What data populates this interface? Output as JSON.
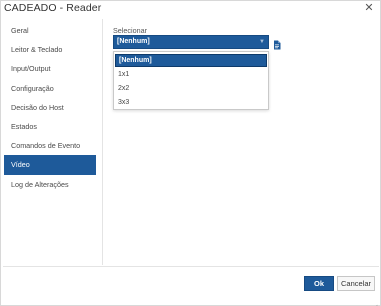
{
  "window": {
    "title": "CADEADO - Reader",
    "close_glyph": "✕"
  },
  "sidebar": {
    "items": [
      {
        "label": "Geral",
        "active": false
      },
      {
        "label": "Leitor & Teclado",
        "active": false
      },
      {
        "label": "Input/Output",
        "active": false
      },
      {
        "label": "Configuração",
        "active": false
      },
      {
        "label": "Decisão do Host",
        "active": false
      },
      {
        "label": "Estados",
        "active": false
      },
      {
        "label": "Comandos de Evento",
        "active": false
      },
      {
        "label": "Vídeo",
        "active": true
      },
      {
        "label": "Log de Alterações",
        "active": false
      }
    ]
  },
  "main": {
    "field_label": "Selecionar",
    "select": {
      "value": "[Nenhum]",
      "arrow_glyph": "▼",
      "icon": "document-icon"
    },
    "dropdown": {
      "options": [
        "[Nenhum]",
        "1x1",
        "2x2",
        "3x3"
      ],
      "selected_index": 0
    }
  },
  "footer": {
    "ok_label": "Ok",
    "cancel_label": "Cancelar"
  },
  "colors": {
    "accent": "#1e5a9a",
    "text": "#4a4a4a",
    "border": "#e4e4e4"
  }
}
